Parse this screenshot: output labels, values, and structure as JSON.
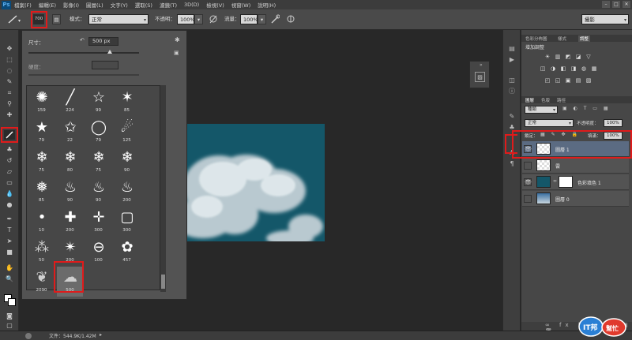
{
  "app": {
    "logo": "Ps",
    "window_controls": [
      "–",
      "□",
      "✕"
    ]
  },
  "menu": [
    "檔案(F)",
    "編輯(E)",
    "影像(I)",
    "圖層(L)",
    "文字(Y)",
    "選取(S)",
    "濾鏡(T)",
    "3D(D)",
    "檢視(V)",
    "視窗(W)",
    "說明(H)"
  ],
  "options": {
    "brush_size": "700",
    "mode_label": "模式：",
    "mode_value": "正常",
    "opacity_label": "不透明：",
    "opacity_value": "100%",
    "flow_label": "流量：",
    "flow_value": "100%",
    "workspace": "攝影"
  },
  "brush_picker": {
    "size_label": "尺寸：",
    "size_value": "500 px",
    "hardness_label": "硬度：",
    "brushes": [
      {
        "num": "159",
        "icon": "ink-splatter"
      },
      {
        "num": "224",
        "icon": "streak"
      },
      {
        "num": "99",
        "icon": "star-outline"
      },
      {
        "num": "85",
        "icon": "stars-cluster"
      },
      {
        "num": "79",
        "icon": "star-textured"
      },
      {
        "num": "22",
        "icon": "star-small"
      },
      {
        "num": "79",
        "icon": "ring"
      },
      {
        "num": "125",
        "icon": "comet"
      },
      {
        "num": "75",
        "icon": "snowflake"
      },
      {
        "num": "80",
        "icon": "snowflake"
      },
      {
        "num": "75",
        "icon": "snowflake"
      },
      {
        "num": "90",
        "icon": "snowflake"
      },
      {
        "num": "85",
        "icon": "snowflake-bold"
      },
      {
        "num": "90",
        "icon": "flame"
      },
      {
        "num": "90",
        "icon": "flame"
      },
      {
        "num": "200",
        "icon": "flame"
      },
      {
        "num": "10",
        "icon": "dot"
      },
      {
        "num": "200",
        "icon": "cross-glow"
      },
      {
        "num": "300",
        "icon": "crosshair"
      },
      {
        "num": "300",
        "icon": "frame"
      },
      {
        "num": "50",
        "icon": "spray"
      },
      {
        "num": "200",
        "icon": "starburst"
      },
      {
        "num": "100",
        "icon": "chain-link"
      },
      {
        "num": "457",
        "icon": "rose"
      },
      {
        "num": "2090",
        "icon": "creature"
      },
      {
        "num": "500",
        "icon": "cloud"
      }
    ]
  },
  "panels": {
    "top_tabs": [
      "色彩分佈圖",
      "樣式",
      "調整"
    ],
    "adjust_title": "增加調整",
    "layer_tabs": [
      "圖層",
      "色版",
      "路徑"
    ],
    "kind_label": "種類",
    "blend_mode": "正常",
    "opacity_label": "不透明度：",
    "opacity_value": "100%",
    "lock_label": "鎖定：",
    "fill_label": "填滿：",
    "fill_value": "100%",
    "layers": [
      {
        "name": "圖層 1",
        "visible": true,
        "selected": true
      },
      {
        "name": "雲",
        "visible": false,
        "selected": false
      },
      {
        "name": "色彩填色 1",
        "visible": true,
        "selected": false
      },
      {
        "name": "圖層 0",
        "visible": false,
        "selected": false
      }
    ]
  },
  "status": {
    "file_info": "文件：544.9K/1.42M",
    "watermark": "iT邦幫忙"
  },
  "colors": {
    "accent_red": "#e01b1b",
    "sky": "#145769",
    "selected_layer": "#5b6b82"
  }
}
